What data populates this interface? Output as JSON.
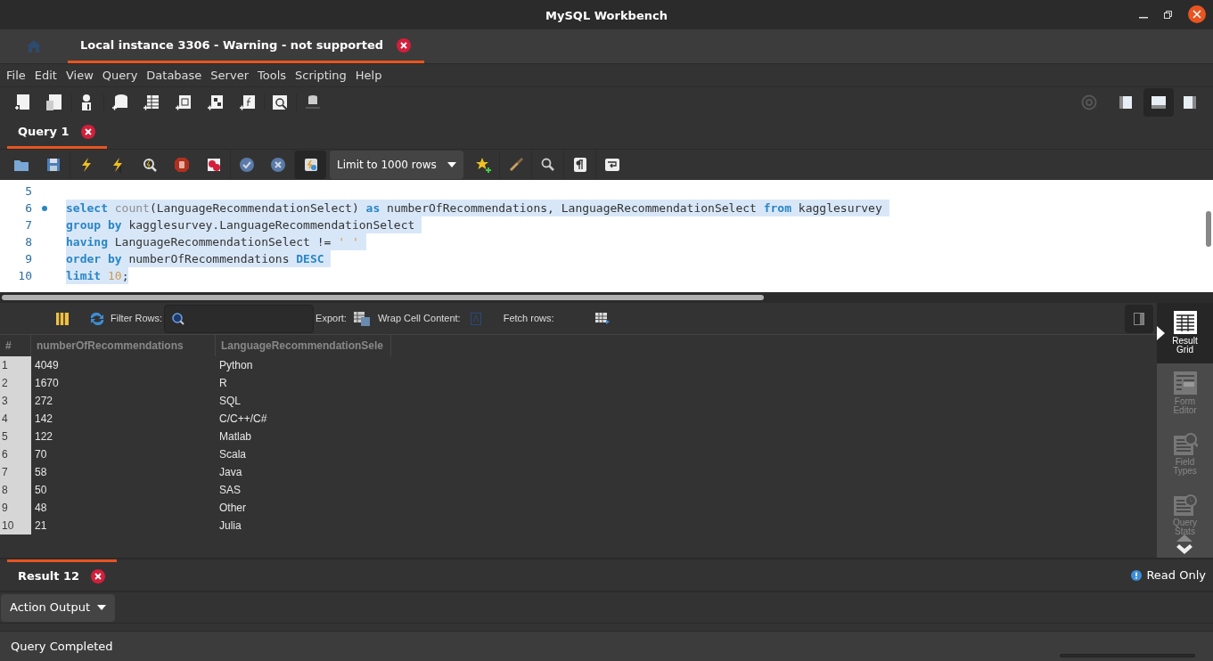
{
  "window": {
    "title": "MySQL Workbench"
  },
  "connection_tabs": [
    {
      "label": "Local instance 3306 - Warning - not supported",
      "selected": true
    }
  ],
  "menu": [
    "File",
    "Edit",
    "View",
    "Query",
    "Database",
    "Server",
    "Tools",
    "Scripting",
    "Help"
  ],
  "query_tabs": [
    {
      "label": "Query 1",
      "selected": true
    }
  ],
  "limit_dropdown": {
    "value": "Limit to 1000 rows"
  },
  "editor": {
    "lines": [
      {
        "number": "5",
        "marker": false
      },
      {
        "number": "6",
        "selected": true,
        "marker": true,
        "tokens": [
          {
            "kind": "keyword",
            "text": "select"
          },
          {
            "kind": "function",
            "text": " count"
          },
          {
            "kind": "plain",
            "text": "(LanguageRecommendationSelect) "
          },
          {
            "kind": "keyword",
            "text": "as"
          },
          {
            "kind": "plain",
            "text": " numberOfRecommendations, LanguageRecommendationSelect "
          },
          {
            "kind": "keyword",
            "text": "from"
          },
          {
            "kind": "plain",
            "text": " kagglesurvey "
          }
        ]
      },
      {
        "number": "7",
        "selected": true,
        "marker": false,
        "tokens": [
          {
            "kind": "keyword",
            "text": "group by"
          },
          {
            "kind": "plain",
            "text": " kagglesurvey.LanguageRecommendationSelect "
          }
        ]
      },
      {
        "number": "8",
        "selected": true,
        "marker": false,
        "tokens": [
          {
            "kind": "keyword",
            "text": "having"
          },
          {
            "kind": "plain",
            "text": " LanguageRecommendationSelect != "
          },
          {
            "kind": "literal",
            "text": "' ' "
          }
        ]
      },
      {
        "number": "9",
        "selected": true,
        "marker": false,
        "tokens": [
          {
            "kind": "keyword",
            "text": "order by"
          },
          {
            "kind": "plain",
            "text": " numberOfRecommendations "
          },
          {
            "kind": "keyword",
            "text": "DESC "
          }
        ]
      },
      {
        "number": "10",
        "selected": true,
        "marker": false,
        "tokens": [
          {
            "kind": "keyword",
            "text": "limit"
          },
          {
            "kind": "literal",
            "text": " 10"
          },
          {
            "kind": "plain",
            "text": ";"
          }
        ]
      }
    ]
  },
  "result_toolbar": {
    "filter_label": "Filter Rows:",
    "export_label": "Export:",
    "wrap_label": "Wrap Cell Content:",
    "fetch_label": "Fetch rows:"
  },
  "grid": {
    "columns": [
      "#",
      "numberOfRecommendations",
      "LanguageRecommendationSele"
    ],
    "rows": [
      [
        "1",
        "4049",
        "Python"
      ],
      [
        "2",
        "1670",
        "R"
      ],
      [
        "3",
        "272",
        "SQL"
      ],
      [
        "4",
        "142",
        "C/C++/C#"
      ],
      [
        "5",
        "122",
        "Matlab"
      ],
      [
        "6",
        "70",
        "Scala"
      ],
      [
        "7",
        "58",
        "Java"
      ],
      [
        "8",
        "50",
        "SAS"
      ],
      [
        "9",
        "48",
        "Other"
      ],
      [
        "10",
        "21",
        "Julia"
      ]
    ]
  },
  "result_views": [
    {
      "kind": "grid",
      "label": "Result Grid",
      "selected": true
    },
    {
      "kind": "form",
      "label": "Form Editor",
      "selected": false
    },
    {
      "kind": "types",
      "label": "Field Types",
      "selected": false
    },
    {
      "kind": "stats",
      "label": "Query Stats",
      "selected": false
    }
  ],
  "result_tabs": [
    {
      "label": "Result 12",
      "selected": true
    }
  ],
  "read_only": "Read Only",
  "output": {
    "dropdown": "Action Output"
  },
  "status_bar": "Query Completed"
}
